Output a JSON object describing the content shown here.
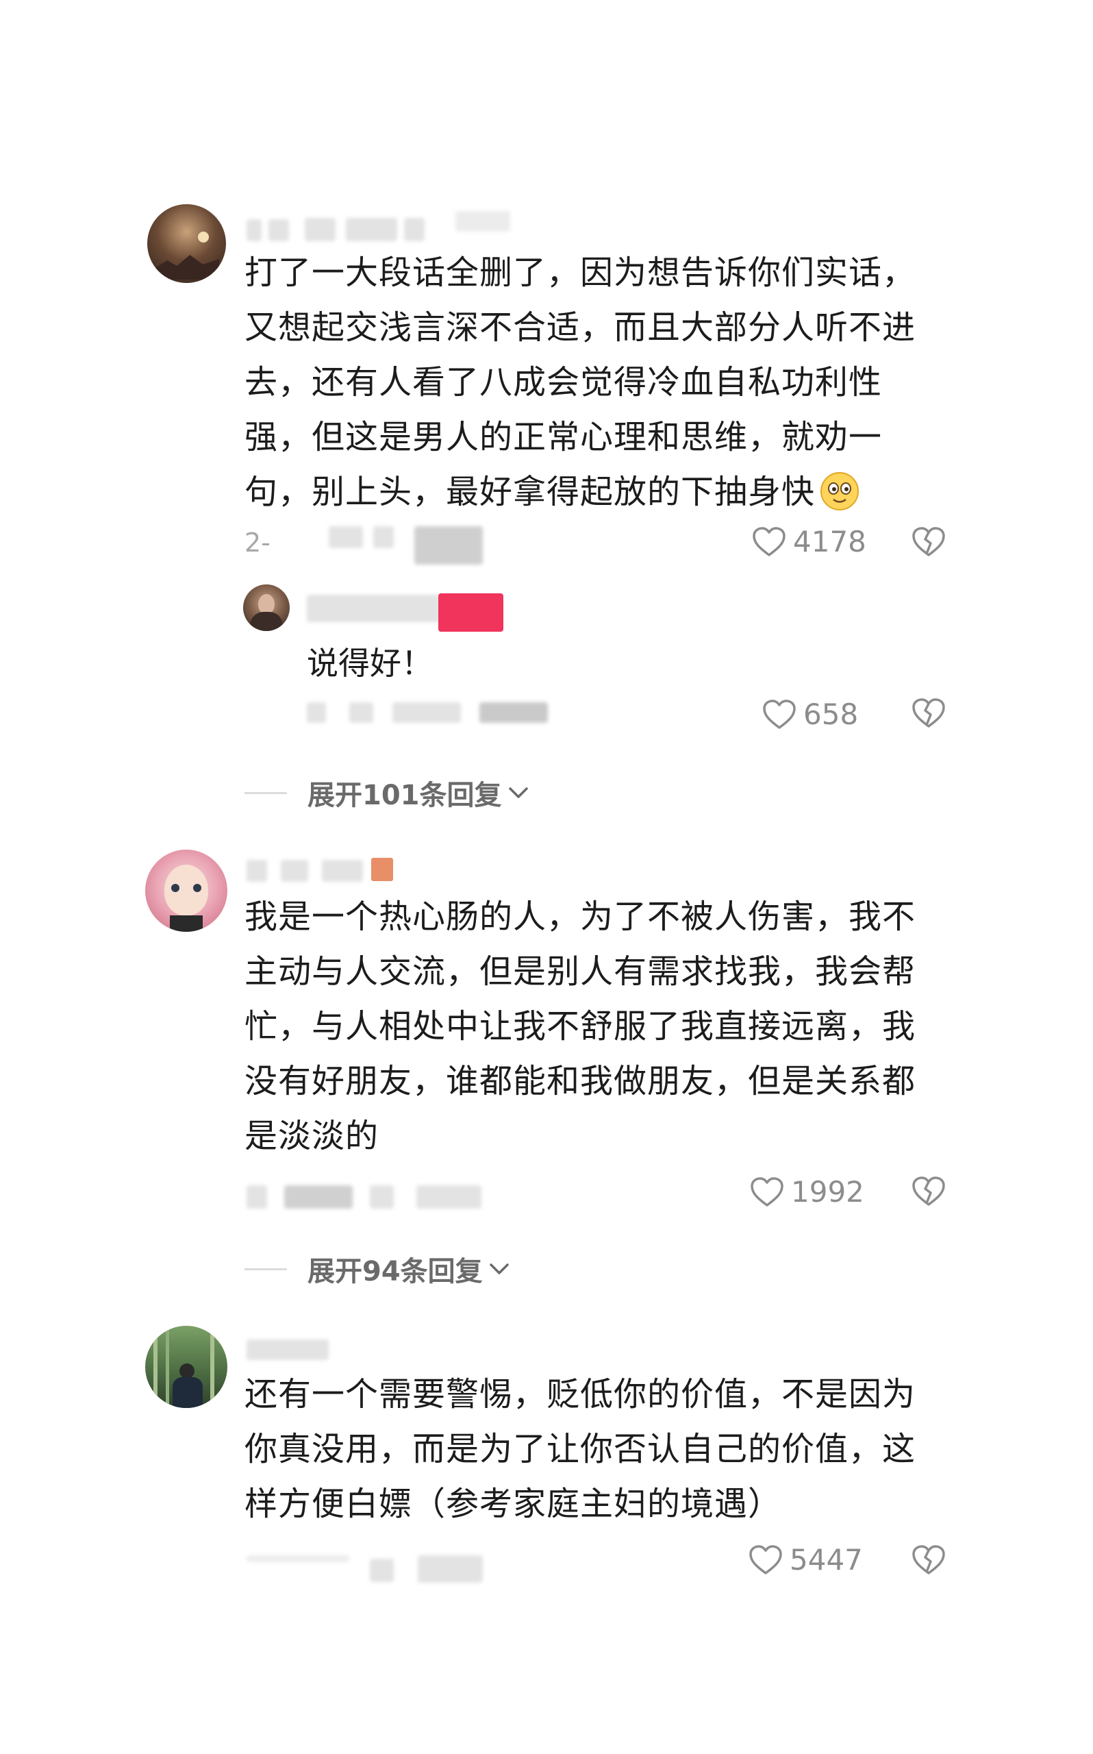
{
  "comments": [
    {
      "text": "打了一大段话全删了，因为想告诉你们实话，\n又想起交浅言深不合适，而且大部分人听不进\n去，还有人看了八成会觉得冷血自私功利性\n强，但这是男人的正常心理和思维，就劝一\n句，别上头，最好拿得起放的下抽身快",
      "emoji_icon": "smiling-face-emoji-icon",
      "date_prefix": "2-",
      "likes": "4178",
      "reply": {
        "text": "说得好！",
        "likes": "658"
      },
      "expand_label": "展开101条回复"
    },
    {
      "text": "我是一个热心肠的人，为了不被人伤害，我不\n主动与人交流，但是别人有需求找我，我会帮\n忙，与人相处中让我不舒服了我直接远离，我\n没有好朋友，谁都能和我做朋友，但是关系都\n是淡淡的",
      "likes": "1992",
      "expand_label": "展开94条回复"
    },
    {
      "text": "还有一个需要警惕，贬低你的价值，不是因为\n你真没用，而是为了让你否认自己的价值，这\n样方便白嫖（参考家庭主妇的境遇）",
      "likes": "5447"
    }
  ],
  "colors": {
    "like_gray": "#8c8c8c",
    "badge_red": "#f0345c",
    "badge_orange": "#e88f68"
  },
  "icons": {
    "like": "heart-outline-icon",
    "dislike": "broken-heart-icon",
    "expand": "chevron-down-icon"
  }
}
